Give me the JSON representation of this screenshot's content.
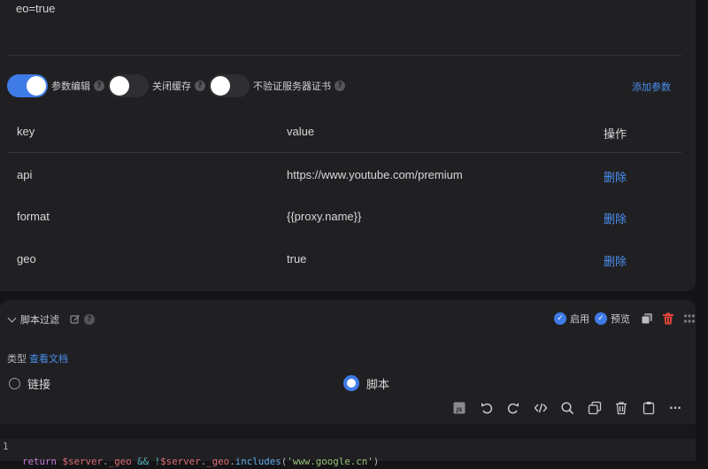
{
  "params_preview": "eo=true",
  "toggles": [
    {
      "label": "参数编辑",
      "on": true
    },
    {
      "label": "关闭缓存",
      "on": false
    },
    {
      "label": "不验证服务器证书",
      "on": false
    }
  ],
  "help_glyph": "?",
  "add_param_label": "添加参数",
  "table": {
    "headers": {
      "key": "key",
      "value": "value",
      "action": "操作"
    },
    "rows": [
      {
        "key": "api",
        "value": "https://www.youtube.com/premium",
        "action": "删除"
      },
      {
        "key": "format",
        "value": "{{proxy.name}}",
        "action": "删除"
      },
      {
        "key": "geo",
        "value": "true",
        "action": "删除"
      }
    ]
  },
  "script_section": {
    "title": "脚本过滤",
    "enable_label": "启用",
    "preview_label": "预览",
    "check_glyph": "✓",
    "type_label": "类型",
    "docs_link": "查看文档",
    "options": [
      {
        "label": "链接",
        "selected": false
      },
      {
        "label": "脚本",
        "selected": true
      }
    ],
    "toolbar_icons": [
      "js-file-icon",
      "undo-icon",
      "redo-icon",
      "code-icon",
      "search-icon",
      "copy-icon",
      "trash-icon",
      "clipboard-icon",
      "more-icon"
    ],
    "js_badge": "JS",
    "more_glyph": "···",
    "code_line_number": "1",
    "code_tokens": {
      "t1": "return",
      "t2": " ",
      "t3": "$server",
      "t4": ".",
      "t5": "_geo",
      "t6": " ",
      "t7": "&&",
      "t8": " ",
      "t9": "!",
      "t10": "$server",
      "t11": ".",
      "t12": "_geo",
      "t13": ".",
      "t14": "includes",
      "t15": "(",
      "t16": "'www.google.cn'",
      "t17": ")"
    }
  },
  "colors": {
    "accent": "#3f7be6",
    "link": "#4a8fef",
    "danger": "#e0453a",
    "panel": "#202023",
    "background": "#141416"
  }
}
